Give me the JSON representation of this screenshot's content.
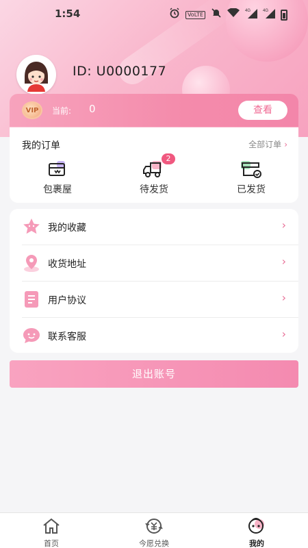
{
  "status_bar": {
    "time": "1:54",
    "icons": [
      "alarm-icon",
      "volte-icon",
      "mute-icon",
      "wifi-icon",
      "signal-4g-icon",
      "signal-4g-icon",
      "battery-icon"
    ],
    "volte": "VoLTE",
    "net1": "4G",
    "net2": "4G"
  },
  "profile": {
    "user_id": "ID: U0000177"
  },
  "points": {
    "label": "当前:",
    "value": "0",
    "view_button": "查看",
    "coin_text": "VIP"
  },
  "orders": {
    "title": "我的订单",
    "all_orders": "全部订单",
    "items": [
      {
        "label": "包裹屋",
        "icon": "package-icon"
      },
      {
        "label": "待发货",
        "icon": "truck-icon",
        "badge": "2"
      },
      {
        "label": "已发货",
        "icon": "shipped-box-icon"
      }
    ]
  },
  "menu": {
    "items": [
      {
        "label": "我的收藏",
        "icon": "star-icon"
      },
      {
        "label": "收货地址",
        "icon": "location-icon"
      },
      {
        "label": "用户协议",
        "icon": "document-icon"
      },
      {
        "label": "联系客服",
        "icon": "chat-icon"
      }
    ]
  },
  "logout": {
    "label": "退出账号"
  },
  "tabbar": {
    "items": [
      {
        "label": "首页",
        "icon": "home-icon"
      },
      {
        "label": "今愿兑换",
        "icon": "exchange-icon"
      },
      {
        "label": "我的",
        "icon": "profile-icon",
        "active": true
      }
    ]
  },
  "colors": {
    "accent": "#f48bab",
    "badge": "#f0587f",
    "chevron": "#e86e96"
  }
}
